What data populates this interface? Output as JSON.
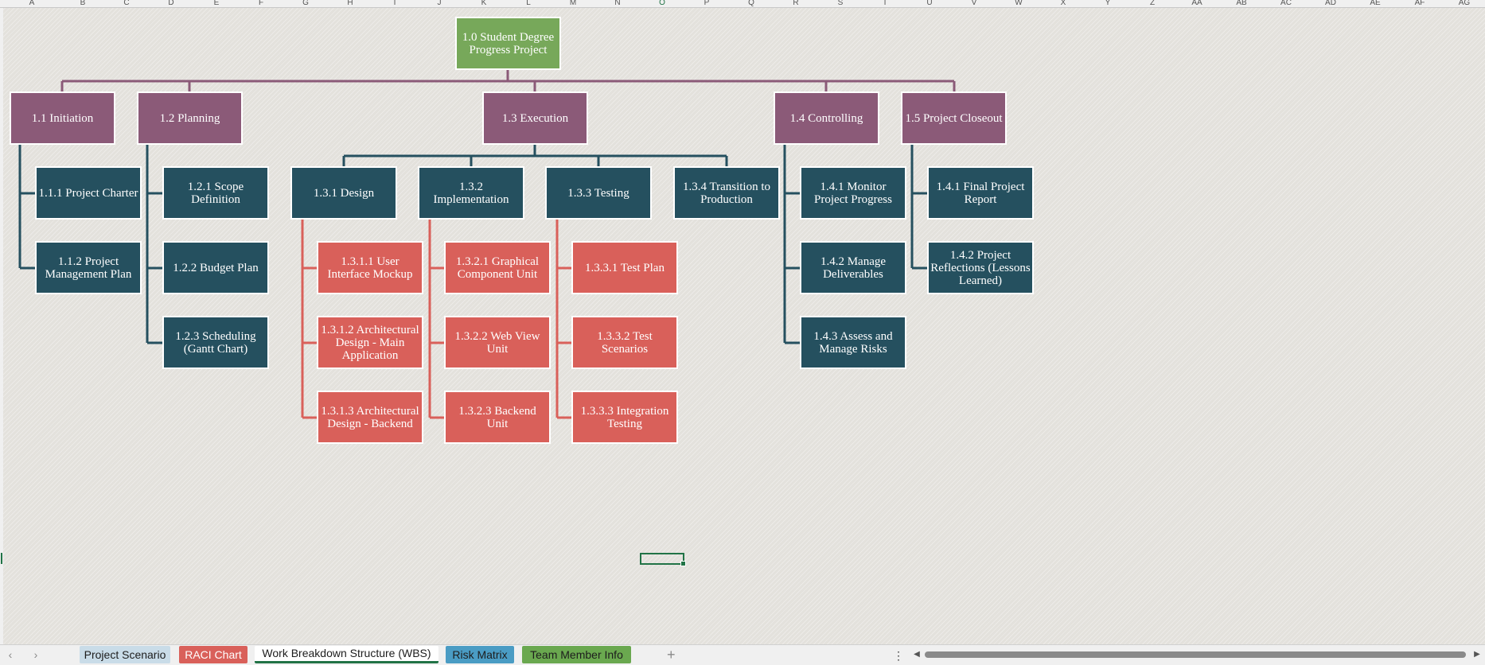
{
  "columns": [
    "A",
    "B",
    "C",
    "D",
    "E",
    "F",
    "G",
    "H",
    "I",
    "J",
    "K",
    "L",
    "M",
    "N",
    "O",
    "P",
    "Q",
    "R",
    "S",
    "T",
    "U",
    "V",
    "W",
    "X",
    "Y",
    "Z",
    "AA",
    "AB",
    "AC",
    "AD",
    "AE",
    "AF",
    "AG"
  ],
  "active_column": "O",
  "colors": {
    "root": "#77a85a",
    "phase": "#8b5a78",
    "task": "#25505f",
    "subtask": "#d9605a",
    "connector_phase": "#8b5a78",
    "connector_task": "#25505f",
    "connector_subtask": "#d9605a",
    "accent": "#217346"
  },
  "wbs": {
    "root": "1.0 Student Degree Progress Project",
    "phases": [
      "1.1 Initiation",
      "1.2 Planning",
      "1.3 Execution",
      "1.4 Controlling",
      "1.5 Project Closeout"
    ],
    "tasks": {
      "initiation": [
        "1.1.1 Project Charter",
        "1.1.2 Project Management Plan"
      ],
      "planning": [
        "1.2.1 Scope Definition",
        "1.2.2 Budget Plan",
        "1.2.3 Scheduling (Gantt Chart)"
      ],
      "execution": [
        "1.3.1 Design",
        "1.3.2 Implementation",
        "1.3.3 Testing",
        "1.3.4 Transition to Production"
      ],
      "controlling": [
        "1.4.1 Monitor Project Progress",
        "1.4.2 Manage Deliverables",
        "1.4.3 Assess and Manage Risks"
      ],
      "closeout": [
        "1.4.1 Final Project Report",
        "1.4.2 Project Reflections (Lessons Learned)"
      ]
    },
    "subtasks": {
      "design": [
        "1.3.1.1 User Interface Mockup",
        "1.3.1.2 Architectural Design - Main Application",
        "1.3.1.3 Architectural Design - Backend"
      ],
      "implementation": [
        "1.3.2.1 Graphical Component Unit",
        "1.3.2.2 Web View Unit",
        "1.3.2.3 Backend Unit"
      ],
      "testing": [
        "1.3.3.1 Test Plan",
        "1.3.3.2 Test Scenarios",
        "1.3.3.3 Integration Testing"
      ]
    }
  },
  "tabs": [
    {
      "label": "Project Scenario",
      "color": "#c9dce8"
    },
    {
      "label": "RACI Chart",
      "color": "#d9605a"
    },
    {
      "label": "Work Breakdown Structure (WBS)",
      "color": "#ffffff"
    },
    {
      "label": "Risk Matrix",
      "color": "#4a9cc4"
    },
    {
      "label": "Team Member Info",
      "color": "#6aa84f"
    }
  ],
  "icons": {
    "prev_sheet": "‹",
    "next_sheet": "›",
    "add_sheet": "+",
    "options": "⋮",
    "scroll_left": "◀",
    "scroll_right": "▶"
  }
}
